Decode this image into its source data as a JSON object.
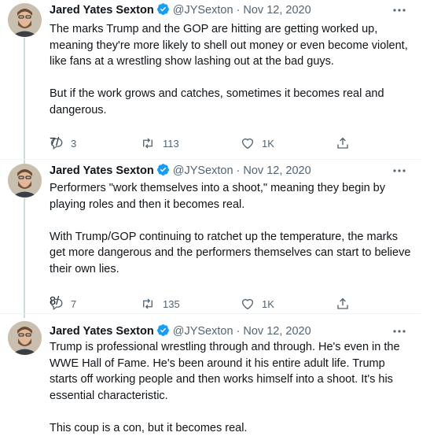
{
  "tweets": [
    {
      "author": "Jared Yates Sexton",
      "handle": "@JYSexton",
      "date": "Nov 12, 2020",
      "paragraphs": [
        "The marks Trump and the GOP are hitting are getting worked up, meaning they're more likely to shell out money or even become violent, like fans at a wrestling show lashing out at the bad guys.",
        "But if the work grows and catches, sometimes it becomes real and dangerous.",
        "7/"
      ],
      "replies": "3",
      "retweets": "113",
      "likes": "1K"
    },
    {
      "author": "Jared Yates Sexton",
      "handle": "@JYSexton",
      "date": "Nov 12, 2020",
      "paragraphs": [
        "Performers \"work themselves into a shoot,\" meaning they begin by playing roles and then it becomes real.",
        "With Trump/GOP continuing to ratchet up the temperature, the marks get more dangerous and the performers themselves can start to believe their own lies.",
        "8/"
      ],
      "replies": "7",
      "retweets": "135",
      "likes": "1K"
    },
    {
      "author": "Jared Yates Sexton",
      "handle": "@JYSexton",
      "date": "Nov 12, 2020",
      "paragraphs": [
        "Trump is professional wrestling through and through. He's even in the WWE Hall of Fame. He's been around it his entire adult life. Trump starts off working people and then works himself into a shoot. It's his essential characteristic.",
        "This coup is a con, but it becomes real."
      ]
    }
  ],
  "separator": "·",
  "colors": {
    "verified": "#1d9bf0",
    "secondary": "#536471",
    "thread": "#cfd9de"
  },
  "icons": {
    "reply": "reply-icon",
    "retweet": "retweet-icon",
    "like": "heart-icon",
    "share": "share-icon",
    "more": "more-icon",
    "verified": "verified-badge-icon"
  }
}
